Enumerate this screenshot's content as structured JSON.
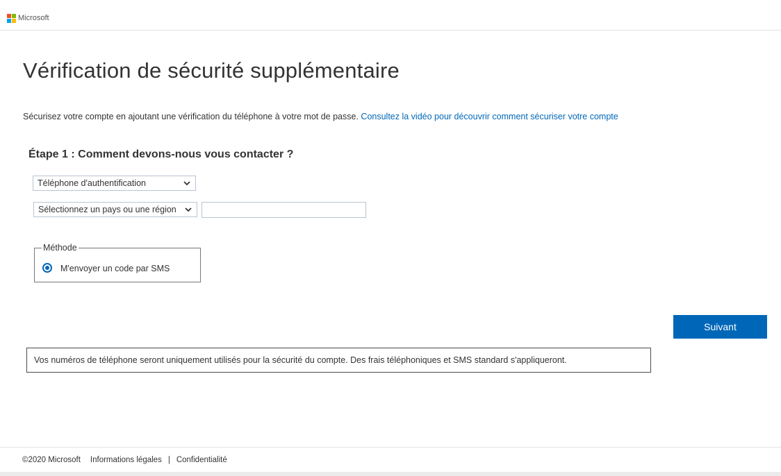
{
  "header": {
    "brand_name": "Microsoft",
    "logo_colors": [
      "#f25022",
      "#7fba00",
      "#00a4ef",
      "#ffb900"
    ]
  },
  "page": {
    "title": "Vérification de sécurité supplémentaire",
    "intro_text": "Sécurisez votre compte en ajoutant une vérification du téléphone à votre mot de passe.",
    "intro_link": "Consultez la vidéo pour découvrir comment sécuriser votre compte"
  },
  "step1": {
    "heading": "Étape 1 : Comment devons-nous vous contacter ?",
    "contact_method_value": "Téléphone d'authentification",
    "country_value": "Sélectionnez un pays ou une région",
    "phone_value": "",
    "method_legend": "Méthode",
    "method_option": "M'envoyer un code par SMS",
    "method_selected": true
  },
  "actions": {
    "next_label": "Suivant"
  },
  "notice": {
    "text": "Vos numéros de téléphone seront uniquement utilisés pour la sécurité du compte. Des frais téléphoniques et SMS standard s'appliqueront."
  },
  "footer": {
    "copyright": "©2020 Microsoft",
    "legal_link": "Informations légales",
    "separator": "|",
    "privacy_link": "Confidentialité"
  },
  "colors": {
    "accent": "#0067b8",
    "text": "#333333"
  },
  "icons": {
    "select_chevron": "chevron-down-icon",
    "logo": "microsoft-logo-icon"
  }
}
